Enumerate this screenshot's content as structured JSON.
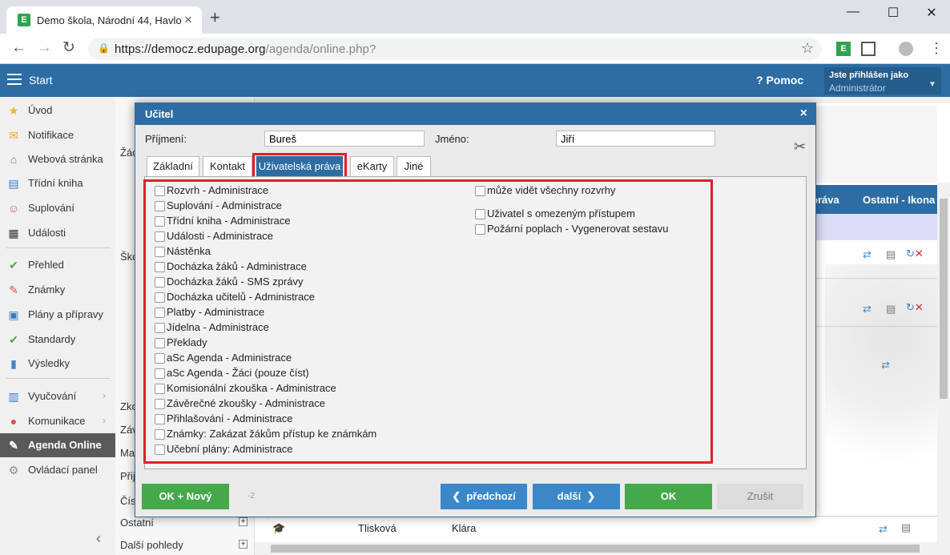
{
  "browser": {
    "tab_title": "Demo škola, Národní 44, Havlov",
    "tab_close": "×",
    "new_tab": "+",
    "url_host": "https://democz.edupage.org",
    "url_path": "/agenda/online.php?",
    "win_min": "—",
    "win_max": "☐",
    "win_close": "✕"
  },
  "topbar": {
    "start": "Start",
    "help": "Pomoc",
    "user_label": "Jste přihlášen jako",
    "user_name": "Administrátor"
  },
  "sidebar": {
    "items": [
      {
        "label": "Úvod",
        "icon": "star-icon",
        "glyph": "★",
        "color": "#e8b62a"
      },
      {
        "label": "Notifikace",
        "icon": "envelope-icon",
        "glyph": "✉",
        "color": "#e8a23a"
      },
      {
        "label": "Webová stránka",
        "icon": "home-icon",
        "glyph": "⌂",
        "color": "#3a9a5b"
      },
      {
        "label": "Třídní kniha",
        "icon": "book-icon",
        "glyph": "▤",
        "color": "#3b7cc4"
      },
      {
        "label": "Suplování",
        "icon": "person-icon",
        "glyph": "☺",
        "color": "#d9534f"
      },
      {
        "label": "Události",
        "icon": "calendar-icon",
        "glyph": "▦",
        "color": "#333"
      },
      {
        "label": "Přehled",
        "icon": "check-icon",
        "glyph": "✔",
        "color": "#45a84b"
      },
      {
        "label": "Známky",
        "icon": "grades-icon",
        "glyph": "✎",
        "color": "#d9534f"
      },
      {
        "label": "Plány a přípravy",
        "icon": "briefcase-icon",
        "glyph": "▣",
        "color": "#3b7cc4"
      },
      {
        "label": "Standardy",
        "icon": "shield-icon",
        "glyph": "✔",
        "color": "#45a84b"
      },
      {
        "label": "Výsledky",
        "icon": "bar-chart-icon",
        "glyph": "▮",
        "color": "#3b87c8"
      },
      {
        "label": "Vyučování",
        "icon": "open-book-icon",
        "glyph": "▥",
        "color": "#3b7cc4"
      },
      {
        "label": "Komunikace",
        "icon": "chat-icon",
        "glyph": "●",
        "color": "#d9534f"
      },
      {
        "label": "Agenda Online",
        "icon": "pen-icon",
        "glyph": "✎",
        "color": "#fff"
      },
      {
        "label": "Ovládací panel",
        "icon": "gear-icon",
        "glyph": "⚙",
        "color": "#888"
      }
    ],
    "collapse": "‹"
  },
  "leftlist": {
    "items": [
      "Žác",
      "Ško",
      "Zko",
      "Záv",
      "Ma",
      "Přij",
      "Čís",
      "Ostatní",
      "Další pohledy"
    ]
  },
  "grid": {
    "headers": [
      "práva",
      "Ostatní - Ikona"
    ],
    "bottom_row": [
      "Tlisková",
      "Klára"
    ]
  },
  "dialog": {
    "title": "Učitel",
    "close": "×",
    "surname_label": "Příjmení:",
    "surname_value": "Bureš",
    "firstname_label": "Jméno:",
    "firstname_value": "Jiří",
    "tabs": [
      "Základní",
      "Kontakt",
      "Uživatelská práva",
      "eKarty",
      "Jiné"
    ],
    "rights_left": [
      "Rozvrh - Administrace",
      "Suplování - Administrace",
      "Třídní kniha - Administrace",
      "Události - Administrace",
      "Nástěnka",
      "Docházka žáků - Administrace",
      "Docházka žáků - SMS zprávy",
      "Docházka učitelů - Administrace",
      "Platby - Administrace",
      "Jídelna - Administrace",
      "Překlady",
      "aSc Agenda - Administrace",
      "aSc Agenda - Žáci (pouze číst)",
      "Komisionální zkouška - Administrace",
      "Závěrečné zkoušky - Administrace",
      "Přihlašování - Administrace",
      "Známky: Zakázat žákům přístup ke známkám",
      "Učební plány: Administrace"
    ],
    "rights_right": [
      "může vidět všechny rozvrhy",
      "Uživatel s omezeným přístupem",
      "Požární poplach - Vygenerovat sestavu"
    ],
    "buttons": {
      "ok_new": "OK + Nový",
      "pager": "-2",
      "prev": "předchozí",
      "next": "další",
      "ok": "OK",
      "cancel": "Zrušit"
    }
  }
}
